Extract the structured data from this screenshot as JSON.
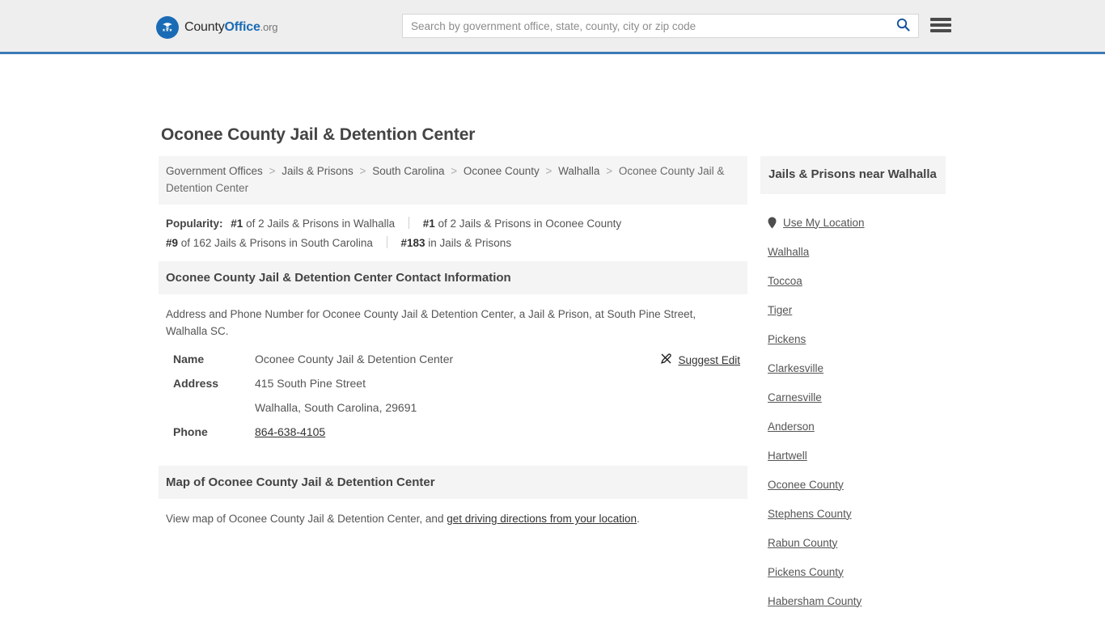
{
  "header": {
    "logo": {
      "part1": "County",
      "part2": "Office",
      "part3": ".org",
      "icon": "eagle-shield-logo"
    },
    "search": {
      "placeholder": "Search by government office, state, county, city or zip code",
      "value": "",
      "button_icon": "search-icon"
    },
    "menu_icon": "hamburger-menu-icon",
    "accent_color": "#3a7ab5"
  },
  "page_title": "Oconee County Jail & Detention Center",
  "breadcrumb": {
    "separator": ">",
    "items": [
      "Government Offices",
      "Jails & Prisons",
      "South Carolina",
      "Oconee County",
      "Walhalla"
    ],
    "current": "Oconee County Jail & Detention Center"
  },
  "popularity": {
    "label": "Popularity:",
    "items": [
      {
        "rank": "#1",
        "text": "of 2 Jails & Prisons in Walhalla"
      },
      {
        "rank": "#1",
        "text": "of 2 Jails & Prisons in Oconee County"
      },
      {
        "rank": "#9",
        "text": "of 162 Jails & Prisons in South Carolina"
      },
      {
        "rank": "#183",
        "text": "in Jails & Prisons"
      }
    ]
  },
  "contact_section": {
    "heading": "Oconee County Jail & Detention Center Contact Information",
    "description": "Address and Phone Number for Oconee County Jail & Detention Center, a Jail & Prison, at South Pine Street, Walhalla SC.",
    "suggest_edit": {
      "label": "Suggest Edit",
      "icon": "edit-pencil-icon"
    },
    "rows": [
      {
        "label": "Name",
        "value": "Oconee County Jail & Detention Center",
        "link": false
      },
      {
        "label": "Address",
        "value": "415 South Pine Street",
        "link": false
      },
      {
        "label": "",
        "value": "Walhalla, South Carolina, 29691",
        "link": false
      },
      {
        "label": "Phone",
        "value": "864-638-4105",
        "link": true
      }
    ]
  },
  "map_section": {
    "heading": "Map of Oconee County Jail & Detention Center",
    "text_before": "View map of Oconee County Jail & Detention Center, and ",
    "link_text": "get driving directions from your location",
    "text_after": "."
  },
  "sidebar": {
    "heading": "Jails & Prisons near Walhalla",
    "items": [
      {
        "label": "Use My Location",
        "icon": "map-pin-icon"
      },
      {
        "label": "Walhalla",
        "icon": null
      },
      {
        "label": "Toccoa",
        "icon": null
      },
      {
        "label": "Tiger",
        "icon": null
      },
      {
        "label": "Pickens",
        "icon": null
      },
      {
        "label": "Clarkesville",
        "icon": null
      },
      {
        "label": "Carnesville",
        "icon": null
      },
      {
        "label": "Anderson",
        "icon": null
      },
      {
        "label": "Hartwell",
        "icon": null
      },
      {
        "label": "Oconee County",
        "icon": null
      },
      {
        "label": "Stephens County",
        "icon": null
      },
      {
        "label": "Rabun County",
        "icon": null
      },
      {
        "label": "Pickens County",
        "icon": null
      },
      {
        "label": "Habersham County",
        "icon": null
      }
    ]
  }
}
